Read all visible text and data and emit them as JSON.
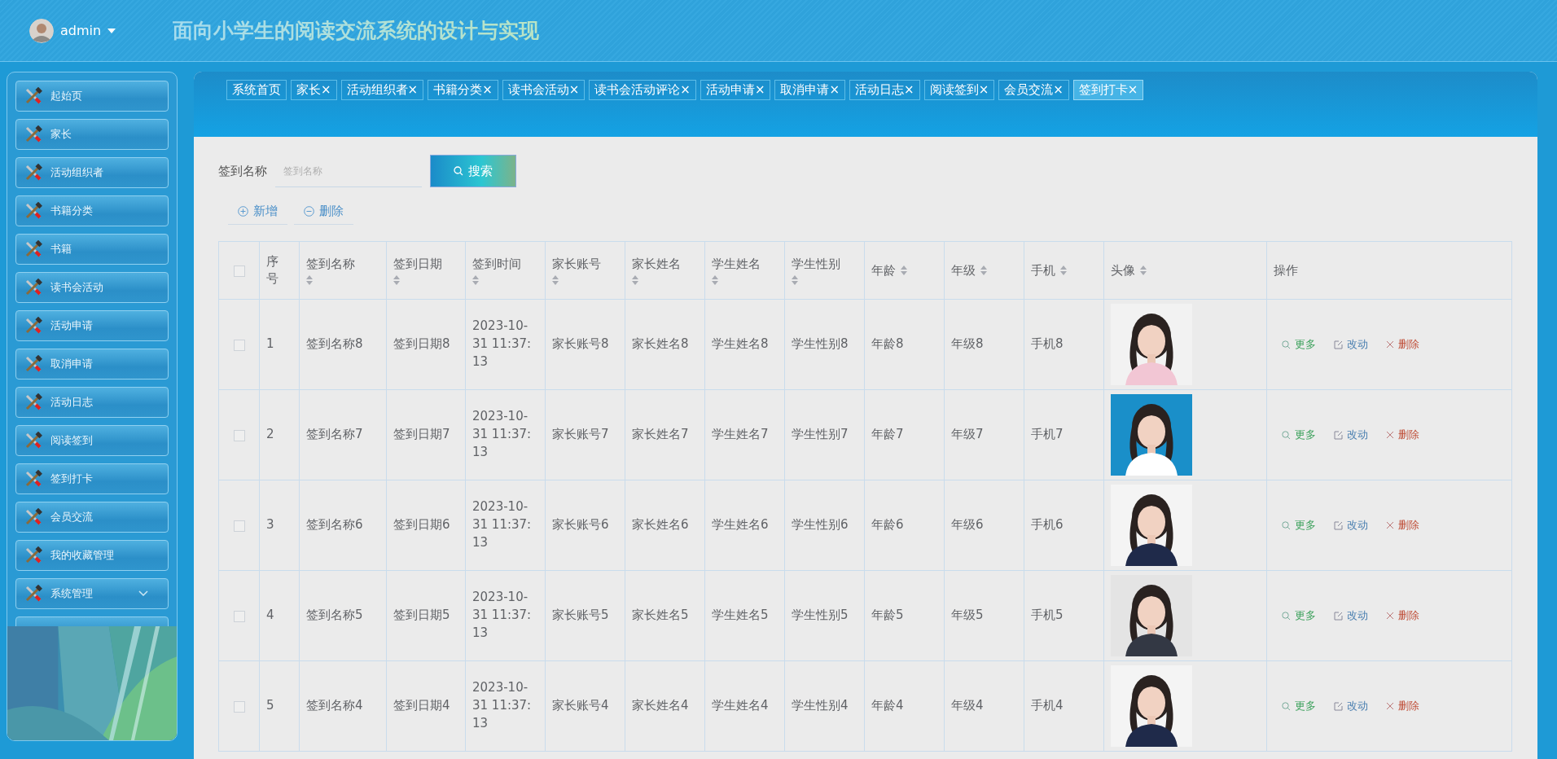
{
  "header": {
    "user": "admin",
    "title": "面向小学生的阅读交流系统的设计与实现"
  },
  "sidebar": {
    "items": [
      {
        "label": "起始页",
        "kind": "link"
      },
      {
        "label": "家长",
        "kind": "link"
      },
      {
        "label": "活动组织者",
        "kind": "link"
      },
      {
        "label": "书籍分类",
        "kind": "link"
      },
      {
        "label": "书籍",
        "kind": "link"
      },
      {
        "label": "读书会活动",
        "kind": "link"
      },
      {
        "label": "活动申请",
        "kind": "link"
      },
      {
        "label": "取消申请",
        "kind": "link"
      },
      {
        "label": "活动日志",
        "kind": "link"
      },
      {
        "label": "阅读签到",
        "kind": "link"
      },
      {
        "label": "签到打卡",
        "kind": "link"
      },
      {
        "label": "会员交流",
        "kind": "link"
      },
      {
        "label": "我的收藏管理",
        "kind": "link"
      },
      {
        "label": "系统管理",
        "kind": "group"
      }
    ]
  },
  "tabs": [
    {
      "label": "系统首页",
      "selected": false
    },
    {
      "label": "家长×",
      "selected": false
    },
    {
      "label": "活动组织者×",
      "selected": false
    },
    {
      "label": "书籍分类×",
      "selected": false
    },
    {
      "label": "读书会活动×",
      "selected": false
    },
    {
      "label": "读书会活动评论×",
      "selected": false
    },
    {
      "label": "活动申请×",
      "selected": false
    },
    {
      "label": "取消申请×",
      "selected": false
    },
    {
      "label": "活动日志×",
      "selected": false
    },
    {
      "label": "阅读签到×",
      "selected": false
    },
    {
      "label": "会员交流×",
      "selected": false
    },
    {
      "label": "签到打卡×",
      "selected": true
    }
  ],
  "search": {
    "label": "签到名称",
    "placeholder": "签到名称",
    "button": "搜索"
  },
  "actions": [
    {
      "label": "新增",
      "kind": "add"
    },
    {
      "label": "删除",
      "kind": "remove"
    }
  ],
  "table": {
    "select_all": {
      "checked": false
    },
    "columns": [
      {
        "label": "序号",
        "sortable": false
      },
      {
        "label": "签到名称",
        "sortable": true
      },
      {
        "label": "签到日期",
        "sortable": true
      },
      {
        "label": "签到时间",
        "sortable": true
      },
      {
        "label": "家长账号",
        "sortable": true
      },
      {
        "label": "家长姓名",
        "sortable": true
      },
      {
        "label": "学生姓名",
        "sortable": true
      },
      {
        "label": "学生性别",
        "sortable": true
      },
      {
        "label": "年龄",
        "sortable": true
      },
      {
        "label": "年级",
        "sortable": true
      },
      {
        "label": "手机",
        "sortable": true
      },
      {
        "label": "头像",
        "sortable": true
      },
      {
        "label": "操作",
        "sortable": false
      }
    ],
    "rows": [
      {
        "checked": false,
        "cells": [
          "1",
          "签到名称8",
          "签到日期8",
          "2023-10-31 11:37:13",
          "家长账号8",
          "家长姓名8",
          "学生姓名8",
          "学生性别8",
          "年龄8",
          "年级8",
          "手机8"
        ],
        "avatar": {
          "kind": "picture"
        },
        "ops": [
          "更多",
          "改动",
          "删除"
        ]
      },
      {
        "checked": false,
        "cells": [
          "2",
          "签到名称7",
          "签到日期7",
          "2023-10-31 11:37:13",
          "家长账号7",
          "家长姓名7",
          "学生姓名7",
          "学生性别7",
          "年龄7",
          "年级7",
          "手机7"
        ],
        "avatar": {
          "kind": "picture"
        },
        "ops": [
          "更多",
          "改动",
          "删除"
        ]
      },
      {
        "checked": false,
        "cells": [
          "3",
          "签到名称6",
          "签到日期6",
          "2023-10-31 11:37:13",
          "家长账号6",
          "家长姓名6",
          "学生姓名6",
          "学生性别6",
          "年龄6",
          "年级6",
          "手机6"
        ],
        "avatar": {
          "kind": "picture"
        },
        "ops": [
          "更多",
          "改动",
          "删除"
        ]
      },
      {
        "checked": false,
        "cells": [
          "4",
          "签到名称5",
          "签到日期5",
          "2023-10-31 11:37:13",
          "家长账号5",
          "家长姓名5",
          "学生姓名5",
          "学生性别5",
          "年龄5",
          "年级5",
          "手机5"
        ],
        "avatar": {
          "kind": "picture"
        },
        "ops": [
          "更多",
          "改动",
          "删除"
        ]
      },
      {
        "checked": false,
        "cells": [
          "5",
          "签到名称4",
          "签到日期4",
          "2023-10-31 11:37:13",
          "家长账号4",
          "家长姓名4",
          "学生姓名4",
          "学生性别4",
          "年龄4",
          "年级4",
          "手机4"
        ],
        "avatar": {
          "kind": "picture"
        },
        "ops": [
          "更多",
          "改动",
          "删除"
        ]
      }
    ]
  }
}
